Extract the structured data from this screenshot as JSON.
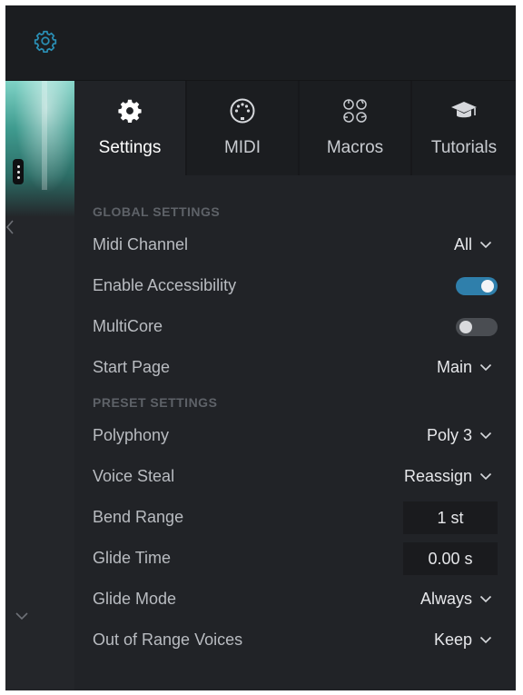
{
  "tabs": [
    {
      "label": "Settings",
      "icon": "gear-icon",
      "active": true
    },
    {
      "label": "MIDI",
      "icon": "midi-din-icon",
      "active": false
    },
    {
      "label": "Macros",
      "icon": "macros-knobs-icon",
      "active": false
    },
    {
      "label": "Tutorials",
      "icon": "graduation-cap-icon",
      "active": false
    }
  ],
  "global_settings": {
    "header": "GLOBAL SETTINGS",
    "midi_channel": {
      "label": "Midi Channel",
      "value": "All"
    },
    "enable_accessibility": {
      "label": "Enable Accessibility",
      "on": true
    },
    "multicore": {
      "label": "MultiCore",
      "on": false
    },
    "start_page": {
      "label": "Start Page",
      "value": "Main"
    }
  },
  "preset_settings": {
    "header": "PRESET SETTINGS",
    "polyphony": {
      "label": "Polyphony",
      "value": "Poly 3"
    },
    "voice_steal": {
      "label": "Voice Steal",
      "value": "Reassign"
    },
    "bend_range": {
      "label": "Bend Range",
      "value": "1 st"
    },
    "glide_time": {
      "label": "Glide Time",
      "value": "0.00 s"
    },
    "glide_mode": {
      "label": "Glide Mode",
      "value": "Always"
    },
    "out_of_range_voices": {
      "label": "Out of Range Voices",
      "value": "Keep"
    }
  },
  "colors": {
    "accent": "#2f7fab",
    "topbar_gear": "#2a8fb5",
    "background": "#212327",
    "label_text": "#b9bcc1",
    "section_header": "#5e6268"
  }
}
